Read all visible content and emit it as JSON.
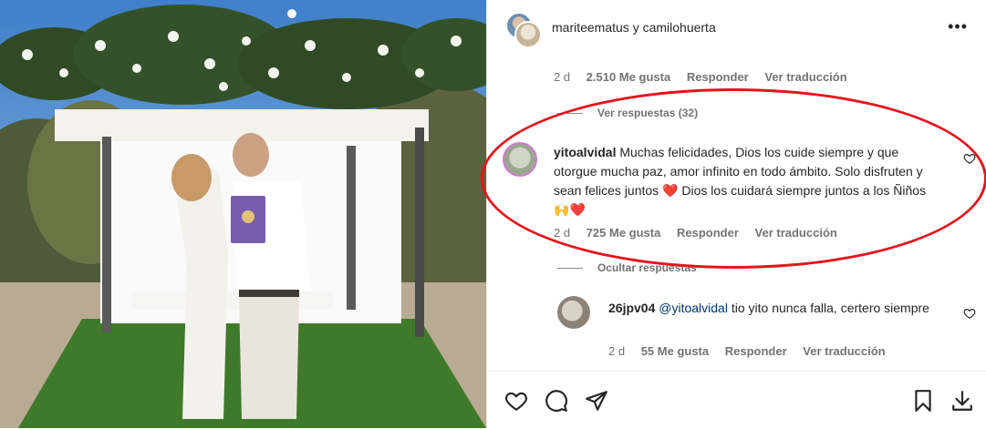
{
  "post": {
    "header_title": "mariteematus y camilohuerta",
    "more_icon": "more-horizontal-icon"
  },
  "prev_comment_meta": {
    "time": "2 d",
    "likes": "2.510 Me gusta",
    "reply": "Responder",
    "translate": "Ver traducción"
  },
  "view_replies": "Ver respuestas (32)",
  "main_comment": {
    "username": "yitoalvidal",
    "text": "Muchas felicidades, Dios los cuide siempre y que otorgue mucha paz, amor infinito en todo ámbito. Solo disfruten y sean felices juntos",
    "text2": "Dios los cuidará siempre juntos a los Ñiños",
    "time": "2 d",
    "likes": "725 Me gusta",
    "reply": "Responder",
    "translate": "Ver traducción"
  },
  "hide_replies": "Ocultar respuestas",
  "reply_comment": {
    "username": "26jpv04",
    "mention": "@yitoalvidal",
    "text": "tio yito nunca falla, certero siempre",
    "time": "2 d",
    "likes": "55 Me gusta",
    "reply": "Responder",
    "translate": "Ver traducción"
  },
  "icons": [
    "heart-icon",
    "comment-icon",
    "share-icon",
    "bookmark-icon",
    "download-icon"
  ],
  "colors": {
    "annotation": "#e3151c",
    "mention": "#00376b",
    "muted": "#737373"
  }
}
